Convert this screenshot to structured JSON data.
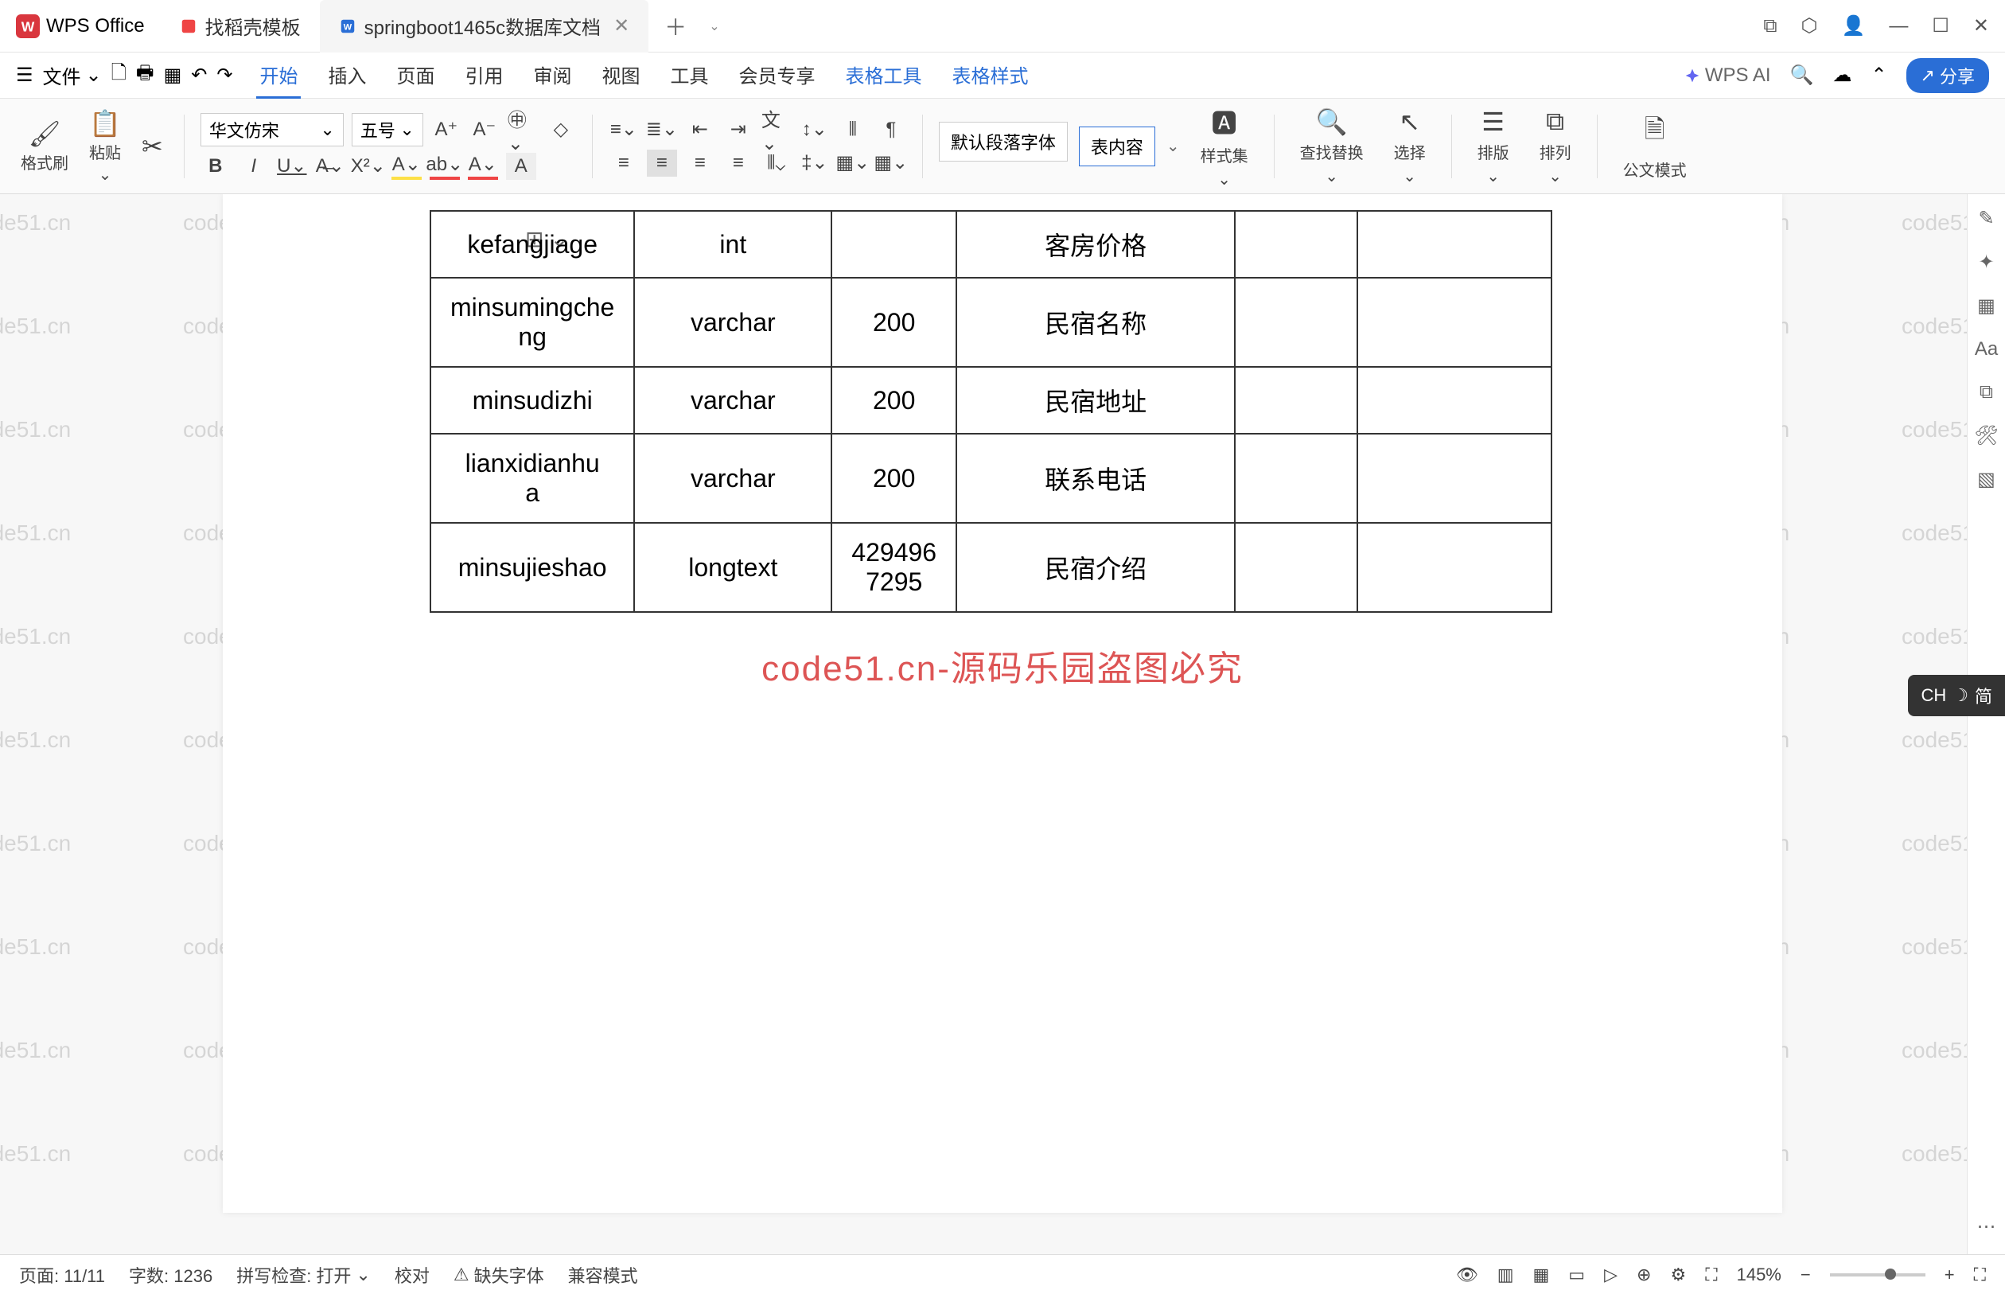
{
  "titlebar": {
    "app_name": "WPS Office",
    "tabs": [
      {
        "label": "找稻壳模板",
        "icon": "template"
      },
      {
        "label": "springboot1465c数据库文档",
        "icon": "word",
        "active": true
      }
    ]
  },
  "menubar": {
    "file": "文件",
    "tabs": [
      "开始",
      "插入",
      "页面",
      "引用",
      "审阅",
      "视图",
      "工具",
      "会员专享",
      "表格工具",
      "表格样式"
    ],
    "active_tab": "开始",
    "wps_ai": "WPS AI",
    "share": "分享"
  },
  "ribbon": {
    "format_painter": "格式刷",
    "paste": "粘贴",
    "font_name": "华文仿宋",
    "font_size": "五号",
    "default_para": "默认段落字体",
    "table_content": "表内容",
    "style_set": "样式集",
    "find_replace": "查找替换",
    "select": "选择",
    "arrange": "排版",
    "arrange2": "排列",
    "gov_mode": "公文模式"
  },
  "document": {
    "watermark_text": "code51.cn",
    "center_watermark": "code51.cn-源码乐园盗图必究",
    "table": {
      "rows": [
        {
          "c1": "kefangjiage",
          "c2": "int",
          "c3": "",
          "c4": "客房价格",
          "c5": "",
          "c6": ""
        },
        {
          "c1": "minsumingche\nng",
          "c2": "varchar",
          "c3": "200",
          "c4": "民宿名称",
          "c5": "",
          "c6": ""
        },
        {
          "c1": "minsudizhi",
          "c2": "varchar",
          "c3": "200",
          "c4": "民宿地址",
          "c5": "",
          "c6": ""
        },
        {
          "c1": "lianxidianhu\na",
          "c2": "varchar",
          "c3": "200",
          "c4": "联系电话",
          "c5": "",
          "c6": ""
        },
        {
          "c1": "minsujieshao",
          "c2": "longtext",
          "c3": "429496\n7295",
          "c4": "民宿介绍",
          "c5": "",
          "c6": ""
        }
      ]
    }
  },
  "ime": {
    "label": "CH",
    "sub": "简"
  },
  "statusbar": {
    "page": "页面: 11/11",
    "words": "字数: 1236",
    "spellcheck": "拼写检查: 打开",
    "proofread": "校对",
    "missing_fonts": "缺失字体",
    "compat_mode": "兼容模式",
    "zoom": "145%"
  }
}
